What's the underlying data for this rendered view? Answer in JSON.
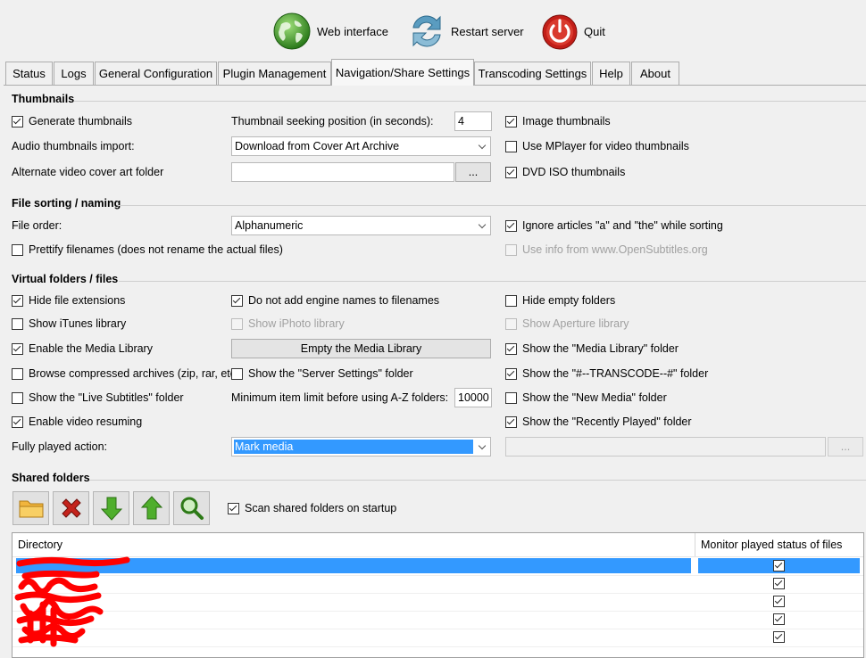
{
  "toolbar": {
    "web_interface": "Web interface",
    "restart_server": "Restart server",
    "quit": "Quit"
  },
  "tabs": [
    "Status",
    "Logs",
    "General Configuration",
    "Plugin Management",
    "Navigation/Share Settings",
    "Transcoding Settings",
    "Help",
    "About"
  ],
  "active_tab": "Navigation/Share Settings",
  "thumbnails": {
    "title": "Thumbnails",
    "generate_thumbnails": "Generate thumbnails",
    "seek_label": "Thumbnail seeking position (in seconds):",
    "seek_value": "4",
    "image_thumbnails": "Image thumbnails",
    "audio_import_label": "Audio thumbnails import:",
    "audio_import_value": "Download from Cover Art Archive",
    "use_mplayer": "Use MPlayer for video thumbnails",
    "alt_cover_label": "Alternate video cover art folder",
    "alt_cover_value": "",
    "browse_label": "...",
    "dvd_iso": "DVD ISO thumbnails"
  },
  "sorting": {
    "title": "File sorting / naming",
    "file_order_label": "File order:",
    "file_order_value": "Alphanumeric",
    "ignore_articles": "Ignore articles \"a\" and \"the\" while sorting",
    "prettify": "Prettify filenames (does not rename the actual files)",
    "opensubtitles": "Use info from www.OpenSubtitles.org"
  },
  "virtual": {
    "title": "Virtual folders / files",
    "hide_ext": "Hide file extensions",
    "no_engine_names": "Do not add engine names to filenames",
    "hide_empty": "Hide empty folders",
    "itunes": "Show iTunes library",
    "iphoto": "Show iPhoto library",
    "aperture": "Show Aperture library",
    "media_library": "Enable the Media Library",
    "empty_media_library": "Empty the Media Library",
    "show_media_library": "Show the \"Media Library\" folder",
    "compressed": "Browse compressed archives (zip, rar, etc.)",
    "server_settings": "Show the \"Server Settings\" folder",
    "transcode": "Show the \"#--TRANSCODE--#\" folder",
    "live_subtitles": "Show the \"Live Subtitles\" folder",
    "az_label": "Minimum item limit before using A-Z folders:",
    "az_value": "10000",
    "new_media": "Show the \"New Media\" folder",
    "video_resuming": "Enable video resuming",
    "recently_played": "Show the \"Recently Played\" folder",
    "fully_played_label": "Fully played action:",
    "fully_played_value": "Mark media",
    "fully_played_extra": "",
    "extra_browse": "..."
  },
  "shared": {
    "title": "Shared folders",
    "scan_on_startup": "Scan shared folders on startup",
    "col_directory": "Directory",
    "col_monitor": "Monitor played status of files",
    "rows": [
      {
        "directory": "",
        "monitor": true
      },
      {
        "directory": "",
        "monitor": true
      },
      {
        "directory": "",
        "monitor": true
      },
      {
        "directory": "",
        "monitor": true
      },
      {
        "directory": "",
        "monitor": true
      }
    ]
  },
  "colors": {
    "selection": "#3399ff",
    "redaction": "#ff0000",
    "globe": "#3a9a2a",
    "restart": "#4a8fb4",
    "quit": "#c0201a"
  }
}
